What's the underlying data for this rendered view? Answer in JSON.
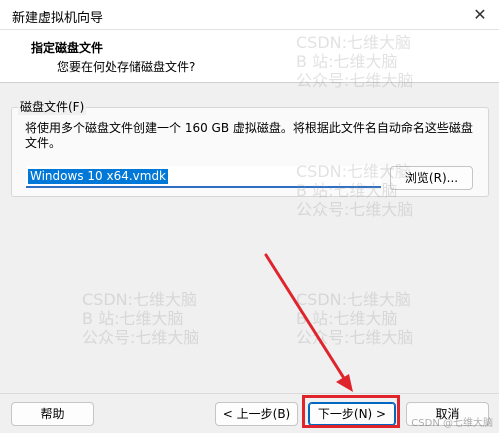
{
  "window": {
    "title": "新建虚拟机向导",
    "close_glyph": "✕"
  },
  "header": {
    "title": "指定磁盘文件",
    "subtitle": "您要在何处存储磁盘文件?"
  },
  "disk_group": {
    "label": "磁盘文件(F)",
    "description": "将使用多个磁盘文件创建一个 160 GB 虚拟磁盘。将根据此文件名自动命名这些磁盘文件。",
    "filename": "Windows 10 x64.vmdk",
    "browse_label": "浏览(R)..."
  },
  "footer": {
    "help_label": "帮助",
    "back_label": "< 上一步(B)",
    "next_label": "下一步(N) >",
    "cancel_label": "取消"
  },
  "watermark": {
    "line1": "CSDN:七维大脑",
    "line2": "B 站:七维大脑",
    "line3": "公众号:七维大脑"
  },
  "credit": "CSDN @七维大脑",
  "colors": {
    "accent": "#0078d7",
    "highlight": "#e0242b"
  }
}
